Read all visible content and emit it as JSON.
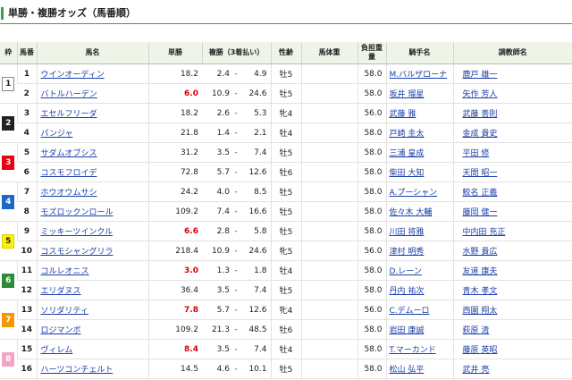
{
  "page_title": "単勝・複勝オッズ（馬番順）",
  "headers": {
    "waku": "枠",
    "umaban": "馬番",
    "horse": "馬名",
    "tansho": "単勝",
    "fukusho": "複勝（3着払い）",
    "sexage": "性齢",
    "weight_horse": "馬体重",
    "kinryo": "負担重量",
    "jockey": "騎手名",
    "trainer": "調教師名"
  },
  "waku_colors": {
    "1": {
      "bg": "#ffffff",
      "fg": "#222222",
      "border": "#888888"
    },
    "2": {
      "bg": "#222222",
      "fg": "#ffffff",
      "border": "#222222"
    },
    "3": {
      "bg": "#e60012",
      "fg": "#ffffff",
      "border": "#e60012"
    },
    "4": {
      "bg": "#1e66c8",
      "fg": "#ffffff",
      "border": "#1e66c8"
    },
    "5": {
      "bg": "#fff200",
      "fg": "#222222",
      "border": "#e0d000"
    },
    "6": {
      "bg": "#2e8b3a",
      "fg": "#ffffff",
      "border": "#2e8b3a"
    },
    "7": {
      "bg": "#f39800",
      "fg": "#ffffff",
      "border": "#f39800"
    },
    "8": {
      "bg": "#f5a3c7",
      "fg": "#ffffff",
      "border": "#f5a3c7"
    }
  },
  "rows": [
    {
      "waku": "1",
      "umaban": "1",
      "horse": "ウインオーディン",
      "tansho": "18.2",
      "fav": false,
      "pmin": "2.4",
      "pdash": "-",
      "pmax": "4.9",
      "sexage": "牡5",
      "weight": "",
      "kinryo": "58.0",
      "jockey": "M.バルザローナ",
      "trainer": "鹿戸 雄一"
    },
    {
      "waku": "1",
      "umaban": "2",
      "horse": "バトルハーデン",
      "tansho": "6.0",
      "fav": true,
      "pmin": "10.9",
      "pdash": "-",
      "pmax": "24.6",
      "sexage": "牡5",
      "weight": "",
      "kinryo": "58.0",
      "jockey": "坂井 瑠星",
      "trainer": "矢作 芳人"
    },
    {
      "waku": "2",
      "umaban": "3",
      "horse": "エセルフリーダ",
      "tansho": "18.2",
      "fav": false,
      "pmin": "2.6",
      "pdash": "-",
      "pmax": "5.3",
      "sexage": "牝4",
      "weight": "",
      "kinryo": "56.0",
      "jockey": "武藤 雅",
      "trainer": "武藤 善則"
    },
    {
      "waku": "2",
      "umaban": "4",
      "horse": "パンジャ",
      "tansho": "21.8",
      "fav": false,
      "pmin": "1.4",
      "pdash": "-",
      "pmax": "2.1",
      "sexage": "牡4",
      "weight": "",
      "kinryo": "58.0",
      "jockey": "戸崎 圭太",
      "trainer": "金成 貴史"
    },
    {
      "waku": "3",
      "umaban": "5",
      "horse": "サダムオブシス",
      "tansho": "31.2",
      "fav": false,
      "pmin": "3.5",
      "pdash": "-",
      "pmax": "7.4",
      "sexage": "牡5",
      "weight": "",
      "kinryo": "58.0",
      "jockey": "三浦 皇成",
      "trainer": "平田 修"
    },
    {
      "waku": "3",
      "umaban": "6",
      "horse": "コスモフロイデ",
      "tansho": "72.8",
      "fav": false,
      "pmin": "5.7",
      "pdash": "-",
      "pmax": "12.6",
      "sexage": "牡6",
      "weight": "",
      "kinryo": "58.0",
      "jockey": "柴田 大知",
      "trainer": "天間 昭一"
    },
    {
      "waku": "4",
      "umaban": "7",
      "horse": "ホウオウムサシ",
      "tansho": "24.2",
      "fav": false,
      "pmin": "4.0",
      "pdash": "-",
      "pmax": "8.5",
      "sexage": "牡5",
      "weight": "",
      "kinryo": "58.0",
      "jockey": "A.プーシャン",
      "trainer": "鮫名 正義"
    },
    {
      "waku": "4",
      "umaban": "8",
      "horse": "モズロックンロール",
      "tansho": "109.2",
      "fav": false,
      "pmin": "7.4",
      "pdash": "-",
      "pmax": "16.6",
      "sexage": "牡5",
      "weight": "",
      "kinryo": "58.0",
      "jockey": "佐々木 大輔",
      "trainer": "藤岡 健一"
    },
    {
      "waku": "5",
      "umaban": "9",
      "horse": "ミッキーツインクル",
      "tansho": "6.6",
      "fav": true,
      "pmin": "2.8",
      "pdash": "-",
      "pmax": "5.8",
      "sexage": "牡5",
      "weight": "",
      "kinryo": "58.0",
      "jockey": "川田 将雅",
      "trainer": "中内田 充正"
    },
    {
      "waku": "5",
      "umaban": "10",
      "horse": "コスモシャングリラ",
      "tansho": "218.4",
      "fav": false,
      "pmin": "10.9",
      "pdash": "-",
      "pmax": "24.6",
      "sexage": "牝5",
      "weight": "",
      "kinryo": "56.0",
      "jockey": "津村 明秀",
      "trainer": "水野 貴広"
    },
    {
      "waku": "6",
      "umaban": "11",
      "horse": "コルレオニス",
      "tansho": "3.0",
      "fav": true,
      "pmin": "1.3",
      "pdash": "-",
      "pmax": "1.8",
      "sexage": "牡4",
      "weight": "",
      "kinryo": "58.0",
      "jockey": "D.レーン",
      "trainer": "友道 康夫"
    },
    {
      "waku": "6",
      "umaban": "12",
      "horse": "エリダヌス",
      "tansho": "36.4",
      "fav": false,
      "pmin": "3.5",
      "pdash": "-",
      "pmax": "7.4",
      "sexage": "牡5",
      "weight": "",
      "kinryo": "58.0",
      "jockey": "丹内 祐次",
      "trainer": "青木 孝文"
    },
    {
      "waku": "7",
      "umaban": "13",
      "horse": "ソリダリティ",
      "tansho": "7.8",
      "fav": true,
      "pmin": "5.7",
      "pdash": "-",
      "pmax": "12.6",
      "sexage": "牝4",
      "weight": "",
      "kinryo": "56.0",
      "jockey": "C.デムーロ",
      "trainer": "西園 翔太"
    },
    {
      "waku": "7",
      "umaban": "14",
      "horse": "ロジマンボ",
      "tansho": "109.2",
      "fav": false,
      "pmin": "21.3",
      "pdash": "-",
      "pmax": "48.5",
      "sexage": "牡6",
      "weight": "",
      "kinryo": "58.0",
      "jockey": "岩田 康誠",
      "trainer": "萩原 清"
    },
    {
      "waku": "8",
      "umaban": "15",
      "horse": "ヴィレム",
      "tansho": "8.4",
      "fav": true,
      "pmin": "3.5",
      "pdash": "-",
      "pmax": "7.4",
      "sexage": "牡4",
      "weight": "",
      "kinryo": "58.0",
      "jockey": "T.マーカンド",
      "trainer": "藤原 英昭"
    },
    {
      "waku": "8",
      "umaban": "16",
      "horse": "ハーツコンチェルト",
      "tansho": "14.5",
      "fav": false,
      "pmin": "4.6",
      "pdash": "-",
      "pmax": "10.1",
      "sexage": "牡5",
      "weight": "",
      "kinryo": "58.0",
      "jockey": "松山 弘平",
      "trainer": "武井 亮"
    }
  ]
}
